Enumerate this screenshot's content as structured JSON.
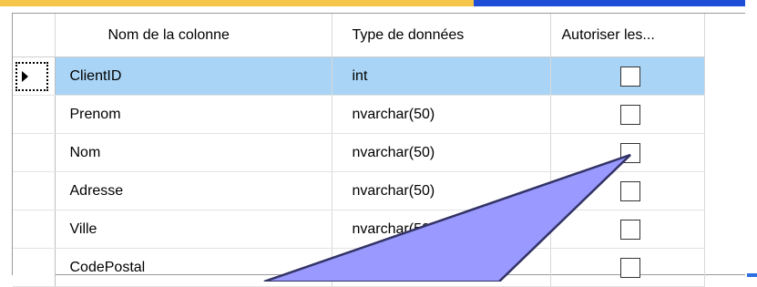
{
  "columns": {
    "name_header": "Nom de la colonne",
    "type_header": "Type de données",
    "null_header": "Autoriser les..."
  },
  "rows": [
    {
      "name": "ClientID",
      "type": "int",
      "allow_nulls": false,
      "primary_key": true
    },
    {
      "name": "Prenom",
      "type": "nvarchar(50)",
      "allow_nulls": false
    },
    {
      "name": "Nom",
      "type": "nvarchar(50)",
      "allow_nulls": false
    },
    {
      "name": "Adresse",
      "type": "nvarchar(50)",
      "allow_nulls": false
    },
    {
      "name": "Ville",
      "type": "nvarchar(50)",
      "allow_nulls": false
    },
    {
      "name": "CodePostal",
      "type": "",
      "allow_nulls": false
    }
  ],
  "colors": {
    "selected_row": "#a9d4f5",
    "callout_fill": "#9999ff",
    "callout_stroke": "#333366"
  },
  "icons": {
    "row_marker": "current-row-arrow-icon",
    "primary_key": "primary-key-icon"
  }
}
